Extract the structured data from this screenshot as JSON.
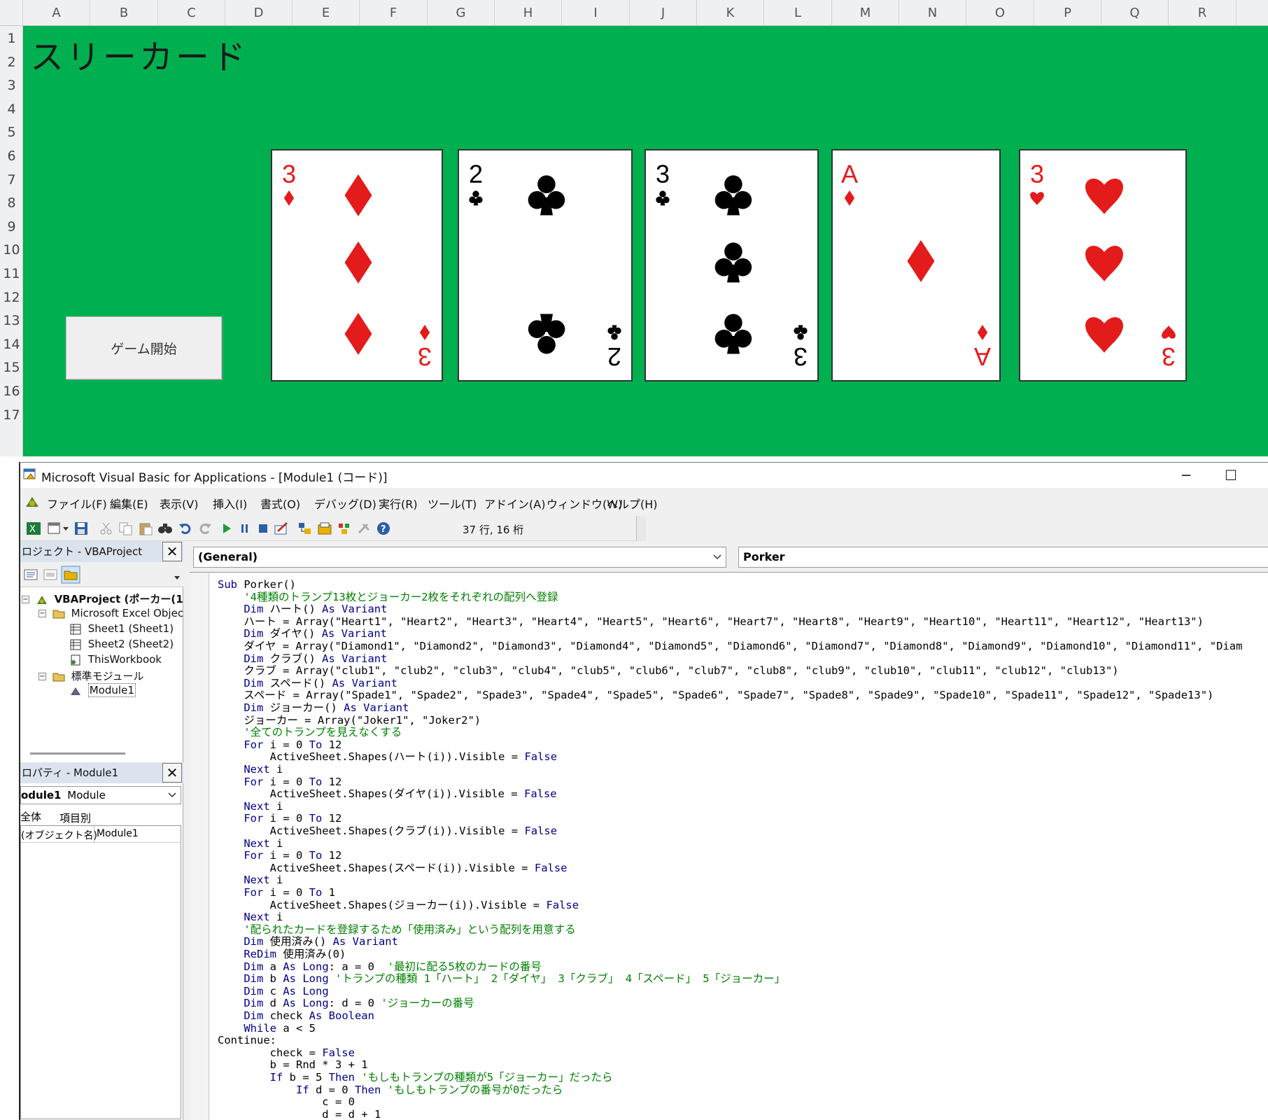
{
  "excel": {
    "columns": [
      "A",
      "B",
      "C",
      "D",
      "E",
      "F",
      "G",
      "H",
      "I",
      "J",
      "K",
      "L",
      "M",
      "N",
      "O",
      "P",
      "Q",
      "R"
    ],
    "rows": [
      "1",
      "2",
      "3",
      "4",
      "5",
      "6",
      "7",
      "8",
      "9",
      "10",
      "11",
      "12",
      "13",
      "14",
      "15",
      "16",
      "17"
    ],
    "title": "スリーカード",
    "start_button_label": "ゲーム開始",
    "cards": [
      {
        "rank": "3",
        "suit": "diamond",
        "color": "#e41b1b"
      },
      {
        "rank": "2",
        "suit": "club",
        "color": "#000000"
      },
      {
        "rank": "3",
        "suit": "club",
        "color": "#000000"
      },
      {
        "rank": "A",
        "suit": "diamond",
        "color": "#e41b1b"
      },
      {
        "rank": "3",
        "suit": "heart",
        "color": "#e41b1b"
      }
    ],
    "background_color": "#00b050"
  },
  "vba": {
    "window_title": "Microsoft Visual Basic for Applications - [Module1 (コード)]",
    "window_controls": {
      "minimize": "─",
      "maximize": "☐"
    },
    "menu": [
      "ファイル(F)",
      "編集(E)",
      "表示(V)",
      "挿入(I)",
      "書式(O)",
      "デバッグ(D)",
      "実行(R)",
      "ツール(T)",
      "アドイン(A)",
      "ウィンドウ(W)",
      "ヘルプ(H)"
    ],
    "cursor_position": "37 行, 16 桁",
    "project_pane": {
      "title": "ロジェクト - VBAProject",
      "close": "✕",
      "tree": [
        {
          "label": "VBAProject (ポーカー(1",
          "bold": true
        },
        {
          "label": "Microsoft Excel Objec"
        },
        {
          "label": "Sheet1 (Sheet1)"
        },
        {
          "label": "Sheet2 (Sheet2)"
        },
        {
          "label": "ThisWorkbook"
        },
        {
          "label": "標準モジュール"
        },
        {
          "label": "Module1"
        }
      ]
    },
    "properties_pane": {
      "title": "ロパティ - Module1",
      "close": "✕",
      "selected_name": "odule1",
      "selected_type": "Module",
      "tabs": [
        "全体",
        "項目別"
      ],
      "row_name": "(オブジェクト名)",
      "row_value": "Module1"
    },
    "combo_object": "(General)",
    "combo_proc": "Porker"
  },
  "code_lines": [
    [
      [
        "kw",
        "Sub "
      ],
      [
        "t",
        "Porker()"
      ]
    ],
    [
      [
        "cm",
        "    '4種類のトランプ13枚とジョーカー2枚をそれぞれの配列へ登録"
      ]
    ],
    [
      [
        "kw",
        "    Dim "
      ],
      [
        "t",
        "ハート() "
      ],
      [
        "kw",
        "As Variant"
      ]
    ],
    [
      [
        "t",
        "    ハート = Array(\"Heart1\", \"Heart2\", \"Heart3\", \"Heart4\", \"Heart5\", \"Heart6\", \"Heart7\", \"Heart8\", \"Heart9\", \"Heart10\", \"Heart11\", \"Heart12\", \"Heart13\")"
      ]
    ],
    [
      [
        "kw",
        "    Dim "
      ],
      [
        "t",
        "ダイヤ() "
      ],
      [
        "kw",
        "As Variant"
      ]
    ],
    [
      [
        "t",
        "    ダイヤ = Array(\"Diamond1\", \"Diamond2\", \"Diamond3\", \"Diamond4\", \"Diamond5\", \"Diamond6\", \"Diamond7\", \"Diamond8\", \"Diamond9\", \"Diamond10\", \"Diamond11\", \"Diam"
      ]
    ],
    [
      [
        "kw",
        "    Dim "
      ],
      [
        "t",
        "クラブ() "
      ],
      [
        "kw",
        "As Variant"
      ]
    ],
    [
      [
        "t",
        "    クラブ = Array(\"club1\", \"club2\", \"club3\", \"club4\", \"club5\", \"club6\", \"club7\", \"club8\", \"club9\", \"club10\", \"club11\", \"club12\", \"club13\")"
      ]
    ],
    [
      [
        "kw",
        "    Dim "
      ],
      [
        "t",
        "スペード() "
      ],
      [
        "kw",
        "As Variant"
      ]
    ],
    [
      [
        "t",
        "    スペード = Array(\"Spade1\", \"Spade2\", \"Spade3\", \"Spade4\", \"Spade5\", \"Spade6\", \"Spade7\", \"Spade8\", \"Spade9\", \"Spade10\", \"Spade11\", \"Spade12\", \"Spade13\")"
      ]
    ],
    [
      [
        "kw",
        "    Dim "
      ],
      [
        "t",
        "ジョーカー() "
      ],
      [
        "kw",
        "As Variant"
      ]
    ],
    [
      [
        "t",
        "    ジョーカー = Array(\"Joker1\", \"Joker2\")"
      ]
    ],
    [
      [
        "cm",
        "    '全てのトランプを見えなくする"
      ]
    ],
    [
      [
        "kw",
        "    For "
      ],
      [
        "t",
        "i = 0 "
      ],
      [
        "kw",
        "To "
      ],
      [
        "t",
        "12"
      ]
    ],
    [
      [
        "t",
        "        ActiveSheet.Shapes(ハート(i)).Visible = "
      ],
      [
        "kw",
        "False"
      ]
    ],
    [
      [
        "kw",
        "    Next "
      ],
      [
        "t",
        "i"
      ]
    ],
    [
      [
        "kw",
        "    For "
      ],
      [
        "t",
        "i = 0 "
      ],
      [
        "kw",
        "To "
      ],
      [
        "t",
        "12"
      ]
    ],
    [
      [
        "t",
        "        ActiveSheet.Shapes(ダイヤ(i)).Visible = "
      ],
      [
        "kw",
        "False"
      ]
    ],
    [
      [
        "kw",
        "    Next "
      ],
      [
        "t",
        "i"
      ]
    ],
    [
      [
        "kw",
        "    For "
      ],
      [
        "t",
        "i = 0 "
      ],
      [
        "kw",
        "To "
      ],
      [
        "t",
        "12"
      ]
    ],
    [
      [
        "t",
        "        ActiveSheet.Shapes(クラブ(i)).Visible = "
      ],
      [
        "kw",
        "False"
      ]
    ],
    [
      [
        "kw",
        "    Next "
      ],
      [
        "t",
        "i"
      ]
    ],
    [
      [
        "kw",
        "    For "
      ],
      [
        "t",
        "i = 0 "
      ],
      [
        "kw",
        "To "
      ],
      [
        "t",
        "12"
      ]
    ],
    [
      [
        "t",
        "        ActiveSheet.Shapes(スペード(i)).Visible = "
      ],
      [
        "kw",
        "False"
      ]
    ],
    [
      [
        "kw",
        "    Next "
      ],
      [
        "t",
        "i"
      ]
    ],
    [
      [
        "kw",
        "    For "
      ],
      [
        "t",
        "i = 0 "
      ],
      [
        "kw",
        "To "
      ],
      [
        "t",
        "1"
      ]
    ],
    [
      [
        "t",
        "        ActiveSheet.Shapes(ジョーカー(i)).Visible = "
      ],
      [
        "kw",
        "False"
      ]
    ],
    [
      [
        "kw",
        "    Next "
      ],
      [
        "t",
        "i"
      ]
    ],
    [
      [
        "cm",
        "    '配られたカードを登録するため「使用済み」という配列を用意する"
      ]
    ],
    [
      [
        "kw",
        "    Dim "
      ],
      [
        "t",
        "使用済み() "
      ],
      [
        "kw",
        "As Variant"
      ]
    ],
    [
      [
        "kw",
        "    ReDim "
      ],
      [
        "t",
        "使用済み(0)"
      ]
    ],
    [
      [
        "kw",
        "    Dim "
      ],
      [
        "t",
        "a "
      ],
      [
        "kw",
        "As Long"
      ],
      [
        "t",
        ": a = 0  "
      ],
      [
        "cm",
        "'最初に配る5枚のカードの番号"
      ]
    ],
    [
      [
        "kw",
        "    Dim "
      ],
      [
        "t",
        "b "
      ],
      [
        "kw",
        "As Long "
      ],
      [
        "cm",
        "'トランプの種類 1「ハート」 2「ダイヤ」 3「クラブ」 4「スペード」 5「ジョーカー」"
      ]
    ],
    [
      [
        "kw",
        "    Dim "
      ],
      [
        "t",
        "c "
      ],
      [
        "kw",
        "As Long"
      ]
    ],
    [
      [
        "kw",
        "    Dim "
      ],
      [
        "t",
        "d "
      ],
      [
        "kw",
        "As Long"
      ],
      [
        "t",
        ": d = 0 "
      ],
      [
        "cm",
        "'ジョーカーの番号"
      ]
    ],
    [
      [
        "kw",
        "    Dim "
      ],
      [
        "t",
        "check "
      ],
      [
        "kw",
        "As Boolean"
      ]
    ],
    [
      [
        "kw",
        "    While "
      ],
      [
        "t",
        "a < 5"
      ]
    ],
    [
      [
        "t",
        "Continue:"
      ]
    ],
    [
      [
        "t",
        "        check = "
      ],
      [
        "kw",
        "False"
      ]
    ],
    [
      [
        "t",
        "        b = Rnd * 3 + 1"
      ]
    ],
    [
      [
        "kw",
        "        If "
      ],
      [
        "t",
        "b = 5 "
      ],
      [
        "kw",
        "Then "
      ],
      [
        "cm",
        "'もしもトランプの種類が5「ジョーカー」だったら"
      ]
    ],
    [
      [
        "kw",
        "            If "
      ],
      [
        "t",
        "d = 0 "
      ],
      [
        "kw",
        "Then "
      ],
      [
        "cm",
        "'もしもトランプの番号が0だったら"
      ]
    ],
    [
      [
        "t",
        "                c = 0"
      ]
    ],
    [
      [
        "t",
        "                d = d + 1"
      ]
    ]
  ]
}
